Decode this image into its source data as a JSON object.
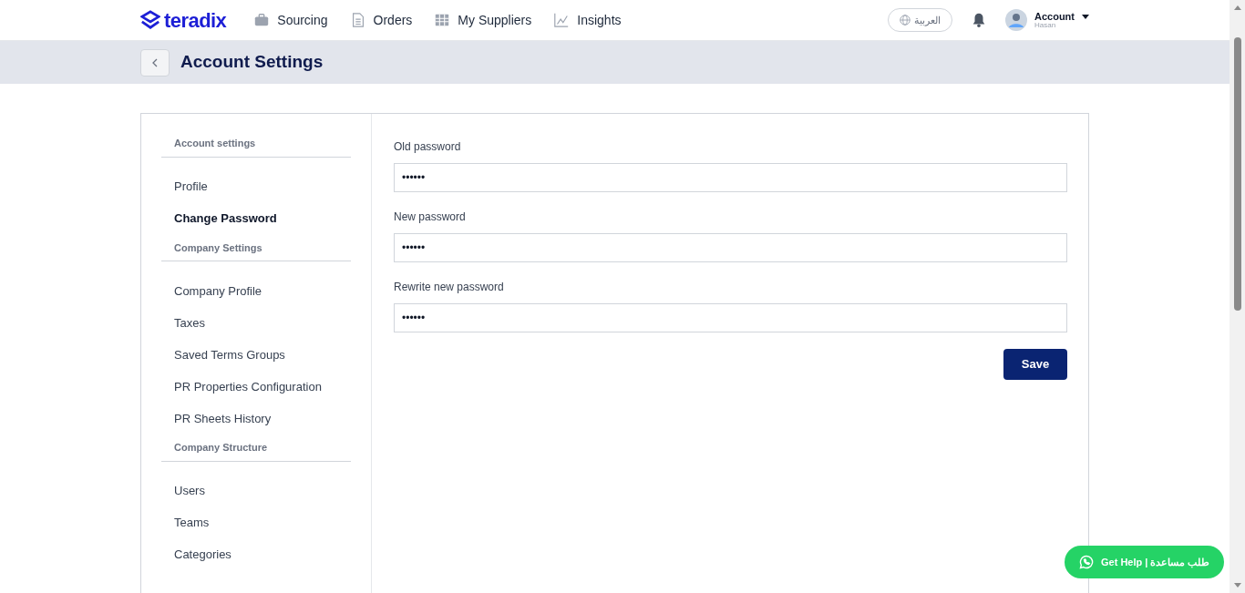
{
  "header": {
    "logo": "teradix",
    "nav": [
      {
        "label": "Sourcing",
        "kind": "briefcase"
      },
      {
        "label": "Orders",
        "kind": "document"
      },
      {
        "label": "My Suppliers",
        "kind": "grid"
      },
      {
        "label": "Insights",
        "kind": "chart"
      }
    ],
    "language": "العربية",
    "account": {
      "label": "Account",
      "user": "Hasan"
    }
  },
  "page_title": "Account Settings",
  "sidebar": [
    {
      "heading": "Account settings",
      "items": [
        {
          "label": "Profile",
          "selected": false
        },
        {
          "label": "Change Password",
          "selected": true
        }
      ]
    },
    {
      "heading": "Company Settings",
      "items": [
        {
          "label": "Company Profile",
          "selected": false
        },
        {
          "label": "Taxes",
          "selected": false
        },
        {
          "label": "Saved Terms Groups",
          "selected": false
        },
        {
          "label": "PR Properties Configuration",
          "selected": false
        },
        {
          "label": "PR Sheets History",
          "selected": false
        }
      ]
    },
    {
      "heading": "Company Structure",
      "items": [
        {
          "label": "Users",
          "selected": false
        },
        {
          "label": "Teams",
          "selected": false
        },
        {
          "label": "Categories",
          "selected": false
        }
      ]
    }
  ],
  "form": {
    "fields": [
      {
        "label": "Old password",
        "value": "••••••"
      },
      {
        "label": "New password",
        "value": "••••••"
      },
      {
        "label": "Rewrite new password",
        "value": "••••••"
      }
    ],
    "submit": "Save"
  },
  "help_button": "Get Help | طلب مساعدة"
}
